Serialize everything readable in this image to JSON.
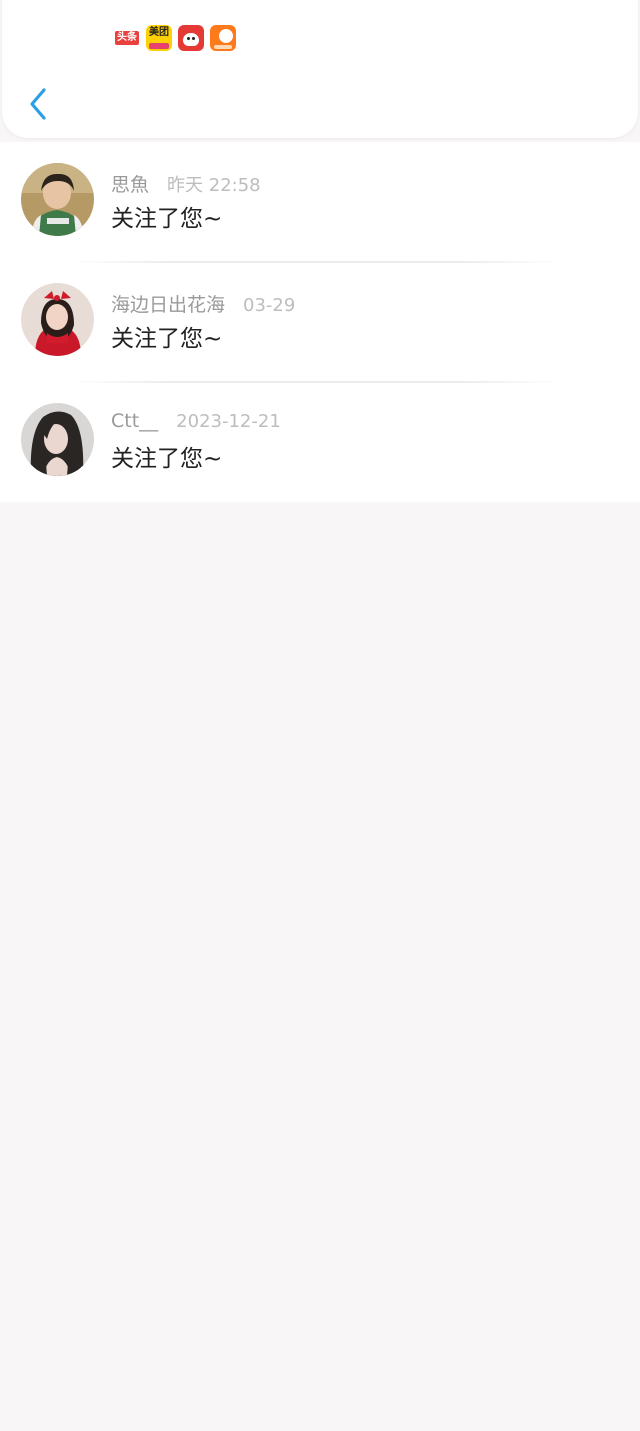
{
  "status_bar": {
    "app_icons": [
      {
        "name": "toutiao-icon",
        "label": "头条"
      },
      {
        "name": "meituan-icon",
        "label": "美团"
      },
      {
        "name": "jd-icon",
        "label": ""
      },
      {
        "name": "taobao-icon",
        "label": ""
      }
    ]
  },
  "nav": {
    "back_icon": "chevron-left-icon",
    "accent_color": "#2a9fe6"
  },
  "followers": [
    {
      "username": "思魚",
      "time": "昨天 22:58",
      "message": "关注了您~"
    },
    {
      "username": "海边日出花海",
      "time": "03-29",
      "message": "关注了您~"
    },
    {
      "username": "Ctt__",
      "time": "2023-12-21",
      "message": "关注了您~"
    }
  ]
}
